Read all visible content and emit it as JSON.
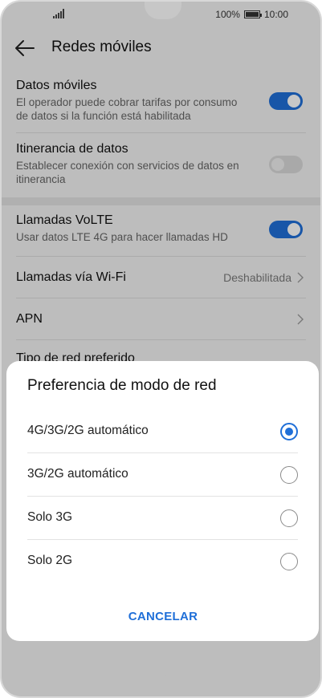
{
  "status": {
    "battery": "100%",
    "time": "10:00"
  },
  "header": {
    "title": "Redes móviles"
  },
  "settings": [
    {
      "title": "Datos móviles",
      "desc": "El operador puede cobrar tarifas por consumo de datos si la función está habilitada",
      "toggle": "on"
    },
    {
      "title": "Itinerancia de datos",
      "desc": "Establecer conexión con servicios de datos en itinerancia",
      "toggle": "off"
    },
    {
      "title": "Llamadas VoLTE",
      "desc": "Usar datos LTE 4G para hacer llamadas HD",
      "toggle": "on"
    },
    {
      "title": "Llamadas vía Wi-Fi",
      "value": "Deshabilitada"
    },
    {
      "title": "APN"
    },
    {
      "title": "Tipo de red preferido"
    }
  ],
  "dialog": {
    "title": "Preferencia de modo de red",
    "options": [
      {
        "label": "4G/3G/2G automático",
        "selected": true
      },
      {
        "label": "3G/2G automático",
        "selected": false
      },
      {
        "label": "Solo 3G",
        "selected": false
      },
      {
        "label": "Solo 2G",
        "selected": false
      }
    ],
    "cancel_label": "CANCELAR"
  },
  "colors": {
    "accent": "#1f6fd8"
  }
}
